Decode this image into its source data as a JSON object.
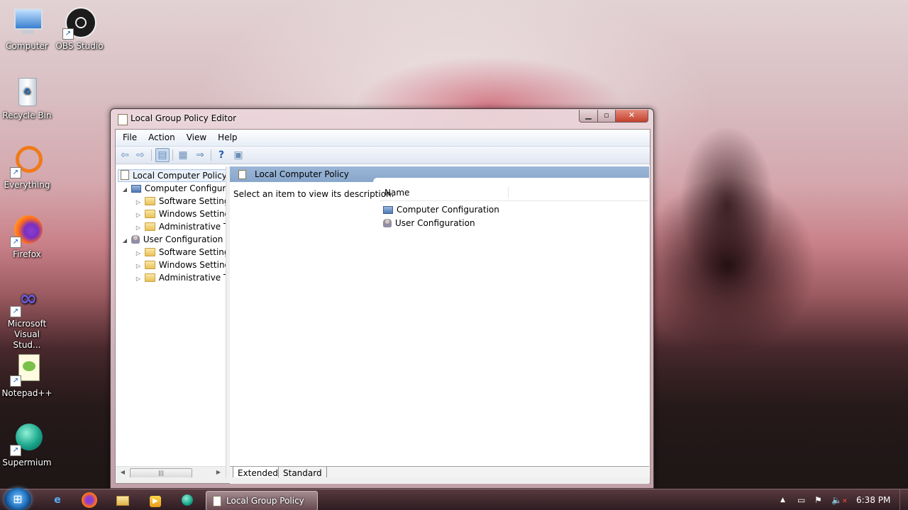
{
  "desktop": {
    "icons": [
      {
        "label": "Computer",
        "icon": "computer-icon"
      },
      {
        "label": "OBS Studio",
        "icon": "obs-icon"
      },
      {
        "label": "Recycle Bin",
        "icon": "recycle-bin-icon"
      },
      {
        "label": "Everything",
        "icon": "everything-icon"
      },
      {
        "label": "Firefox",
        "icon": "firefox-icon"
      },
      {
        "label": "Microsoft Visual Stud...",
        "icon": "visual-studio-icon"
      },
      {
        "label": "Notepad++",
        "icon": "notepadpp-icon"
      },
      {
        "label": "Supermium",
        "icon": "supermium-icon"
      }
    ]
  },
  "window": {
    "title": "Local Group Policy Editor",
    "menu": [
      "File",
      "Action",
      "View",
      "Help"
    ],
    "tree": [
      {
        "label": "Local Computer Policy"
      },
      {
        "label": "Computer Configura"
      },
      {
        "label": "Software Settings"
      },
      {
        "label": "Windows Setting"
      },
      {
        "label": "Administrative Te"
      },
      {
        "label": "User Configuration"
      },
      {
        "label": "Software Settings"
      },
      {
        "label": "Windows Setting"
      },
      {
        "label": "Administrative Te"
      }
    ],
    "right_header": "Local Computer Policy",
    "description": "Select an item to view its description.",
    "column_name": "Name",
    "list": [
      "Computer Configuration",
      "User Configuration"
    ],
    "tabs": [
      "Extended",
      "Standard"
    ]
  },
  "taskbar": {
    "active_task": "Local Group Policy E...",
    "clock": "6:38 PM"
  },
  "colors": {
    "accent": "#88a7cc",
    "taskbar": "#3d262b"
  }
}
